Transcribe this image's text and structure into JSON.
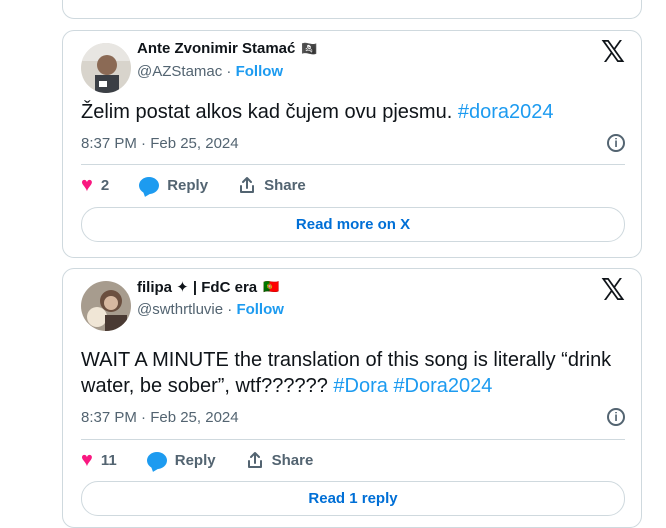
{
  "tweets": [
    {
      "display_name": "Ante Zvonimir Stamać",
      "emoji": "🏴‍☠️",
      "handle": "@AZStamac",
      "follow": "Follow",
      "text": "Želim postat alkos kad čujem ovu pjesmu.",
      "hashtags": [
        "#dora2024"
      ],
      "time": "8:37 PM · Feb 25, 2024",
      "likes": "2",
      "reply": "Reply",
      "share": "Share",
      "footer_button": "Read more on X"
    },
    {
      "display_name": "filipa ✦ | FdC era",
      "emoji": "🇵🇹",
      "handle": "@swthrtluvie",
      "follow": "Follow",
      "text": "WAIT A MINUTE the translation of this song is literally “drink water, be sober”, wtf??????",
      "hashtags": [
        "#Dora",
        "#Dora2024"
      ],
      "time": "8:37 PM · Feb 25, 2024",
      "likes": "11",
      "reply": "Reply",
      "share": "Share",
      "footer_button": "Read 1 reply"
    }
  ],
  "brand": {
    "x_logo": "𝕏",
    "accent": "#1d9bf0",
    "like_color": "#f91880"
  }
}
